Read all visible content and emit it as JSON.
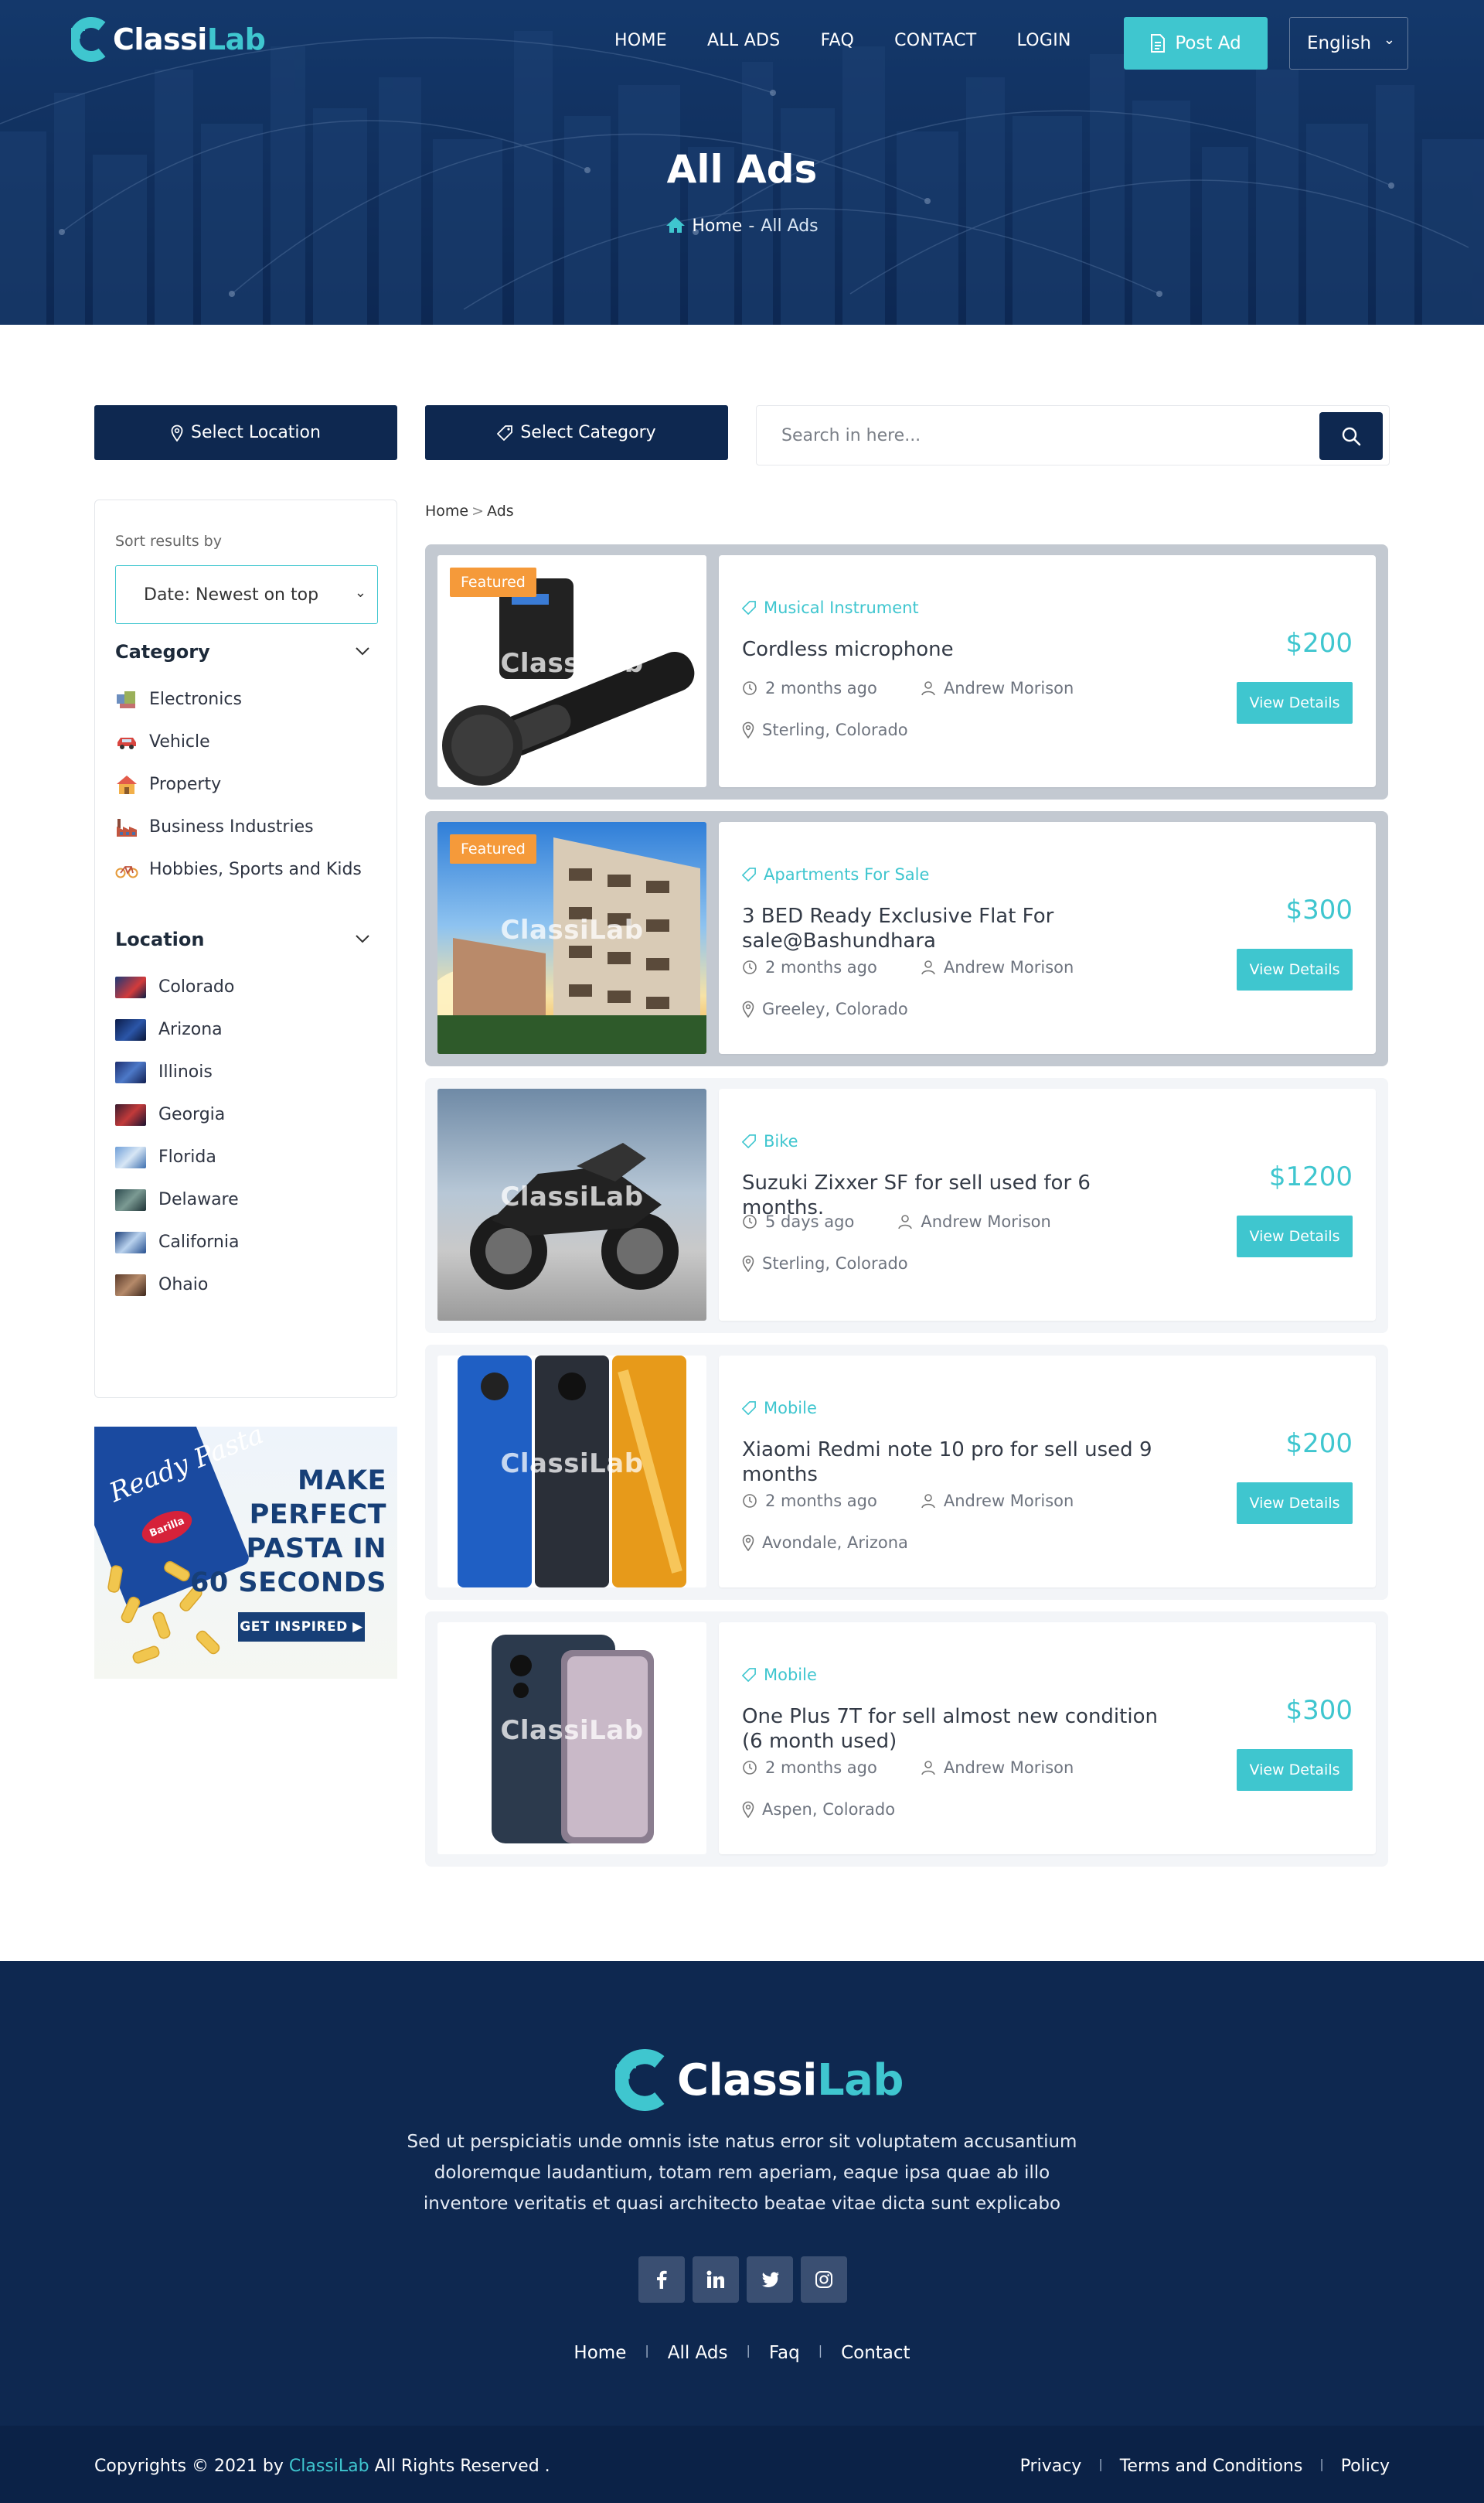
{
  "header": {
    "logo": {
      "part1": "Classi",
      "part2": "Lab"
    },
    "nav": [
      "HOME",
      "ALL ADS",
      "FAQ",
      "CONTACT",
      "LOGIN"
    ],
    "post_ad": "Post Ad",
    "language": "English",
    "title": "All Ads",
    "breadcrumb": {
      "home": "Home",
      "separator": "-",
      "current": "All Ads"
    }
  },
  "filters": {
    "location_button": "Select Location",
    "category_button": "Select Category",
    "search_placeholder": "Search in here..."
  },
  "sidebar": {
    "sort_label": "Sort results by",
    "sort_value": "Date: Newest on top",
    "category_heading": "Category",
    "categories": [
      {
        "label": "Electronics",
        "icon": "electronics-icon"
      },
      {
        "label": "Vehicle",
        "icon": "car-icon"
      },
      {
        "label": "Property",
        "icon": "house-icon"
      },
      {
        "label": "Business Industries",
        "icon": "factory-icon"
      },
      {
        "label": "Hobbies, Sports and Kids",
        "icon": "bicycle-icon"
      }
    ],
    "location_heading": "Location",
    "locations": [
      "Colorado",
      "Arizona",
      "Illinois",
      "Georgia",
      "Florida",
      "Delaware",
      "California",
      "Ohaio"
    ]
  },
  "promo": {
    "bag_text": "Ready Pasta",
    "brand": "Barilla",
    "headline": [
      "MAKE",
      "PERFECT",
      "PASTA IN",
      "60 SECONDS"
    ],
    "cta": "GET INSPIRED ▶"
  },
  "list": {
    "breadcrumb": {
      "home": "Home",
      "separator": ">",
      "current": "Ads"
    },
    "watermark": "ClassiLab",
    "ads": [
      {
        "featured": true,
        "badge": "Featured",
        "category": "Musical Instrument",
        "title": "Cordless microphone",
        "time": "2 months ago",
        "author": "Andrew Morison",
        "location": "Sterling, Colorado",
        "price": "$200",
        "button": "View Details",
        "image": "microphone"
      },
      {
        "featured": true,
        "badge": "Featured",
        "category": "Apartments For Sale",
        "title": "3 BED Ready Exclusive Flat For sale@Bashundhara",
        "time": "2 months ago",
        "author": "Andrew Morison",
        "location": "Greeley, Colorado",
        "price": "$300",
        "button": "View Details",
        "image": "building"
      },
      {
        "featured": false,
        "badge": "",
        "category": "Bike",
        "title": "Suzuki Zixxer SF for sell used for 6 months.",
        "time": "5 days ago",
        "author": "Andrew Morison",
        "location": "Sterling, Colorado",
        "price": "$1200",
        "button": "View Details",
        "image": "motorbike"
      },
      {
        "featured": false,
        "badge": "",
        "category": "Mobile",
        "title": "Xiaomi Redmi note 10 pro for sell used 9 months",
        "time": "2 months ago",
        "author": "Andrew Morison",
        "location": "Avondale, Arizona",
        "price": "$200",
        "button": "View Details",
        "image": "phones-poco"
      },
      {
        "featured": false,
        "badge": "",
        "category": "Mobile",
        "title": "One Plus 7T for sell almost new condition (6 month used)",
        "time": "2 months ago",
        "author": "Andrew Morison",
        "location": "Aspen, Colorado",
        "price": "$300",
        "button": "View Details",
        "image": "phone-oneplus"
      }
    ]
  },
  "footer": {
    "description": "Sed ut perspiciatis unde omnis iste natus error sit voluptatem accusantium doloremque laudantium, totam rem aperiam, eaque ipsa quae ab illo inventore veritatis et quasi architecto beatae vitae dicta sunt explicabo",
    "socials": [
      "facebook-icon",
      "linkedin-icon",
      "twitter-icon",
      "instagram-icon"
    ],
    "links": [
      "Home",
      "All Ads",
      "Faq",
      "Contact"
    ],
    "copyright_prefix": "Copyrights © 2021 by ",
    "copyright_brand": "ClassiLab",
    "copyright_suffix": " All Rights Reserved .",
    "legal_links": [
      "Privacy",
      "Terms and Conditions",
      "Policy"
    ]
  },
  "colors": {
    "accent": "#3fc6cf",
    "navy": "#0e2850",
    "featured_badge": "#f59a3a"
  }
}
